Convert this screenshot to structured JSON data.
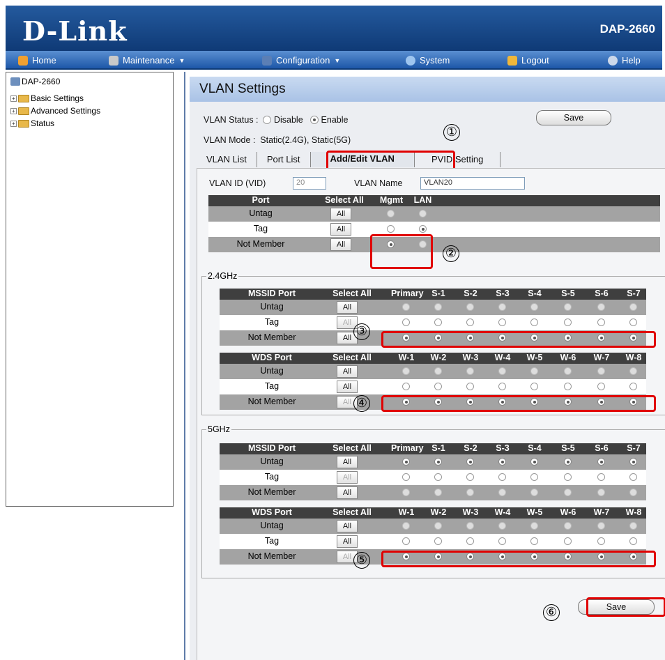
{
  "brand": {
    "logo": "D-Link",
    "model": "DAP-2660"
  },
  "menu": {
    "home": "Home",
    "maintenance": "Maintenance",
    "configuration": "Configuration",
    "system": "System",
    "logout": "Logout",
    "help": "Help"
  },
  "tree": {
    "root": "DAP-2660",
    "basic": "Basic Settings",
    "advanced": "Advanced Settings",
    "status": "Status"
  },
  "page": {
    "title": "VLAN Settings"
  },
  "vlan": {
    "status_label": "VLAN Status :",
    "disable": "Disable",
    "enable": "Enable",
    "mode_label": "VLAN Mode :",
    "mode_value": "Static(2.4G), Static(5G)",
    "save": "Save"
  },
  "tabs": [
    "VLAN List",
    "Port List",
    "Add/Edit VLAN",
    "PVID Setting"
  ],
  "form": {
    "vid_label": "VLAN ID (VID)",
    "vid_value": "20",
    "name_label": "VLAN Name",
    "name_value": "VLAN20"
  },
  "port_table": {
    "headers": [
      "Port",
      "Select All",
      "Mgmt",
      "LAN"
    ],
    "rows": [
      "Untag",
      "Tag",
      "Not Member"
    ],
    "all": "All"
  },
  "sections": {
    "g24": "2.4GHz",
    "g5": "5GHz"
  },
  "mssid": {
    "headers": [
      "MSSID Port",
      "Select All",
      "Primary",
      "S-1",
      "S-2",
      "S-3",
      "S-4",
      "S-5",
      "S-6",
      "S-7"
    ]
  },
  "wds": {
    "headers": [
      "WDS Port",
      "Select All",
      "W-1",
      "W-2",
      "W-3",
      "W-4",
      "W-5",
      "W-6",
      "W-7",
      "W-8"
    ]
  },
  "rows": [
    "Untag",
    "Tag",
    "Not Member"
  ],
  "callouts": [
    "①",
    "②",
    "③",
    "④",
    "⑤",
    "⑥"
  ],
  "bottom_save": "Save",
  "colors": {
    "header": "#1a4c8e",
    "highlight": "#e00000",
    "grid_head": "#3f3f3f",
    "grid_gray": "#a3a3a3"
  }
}
